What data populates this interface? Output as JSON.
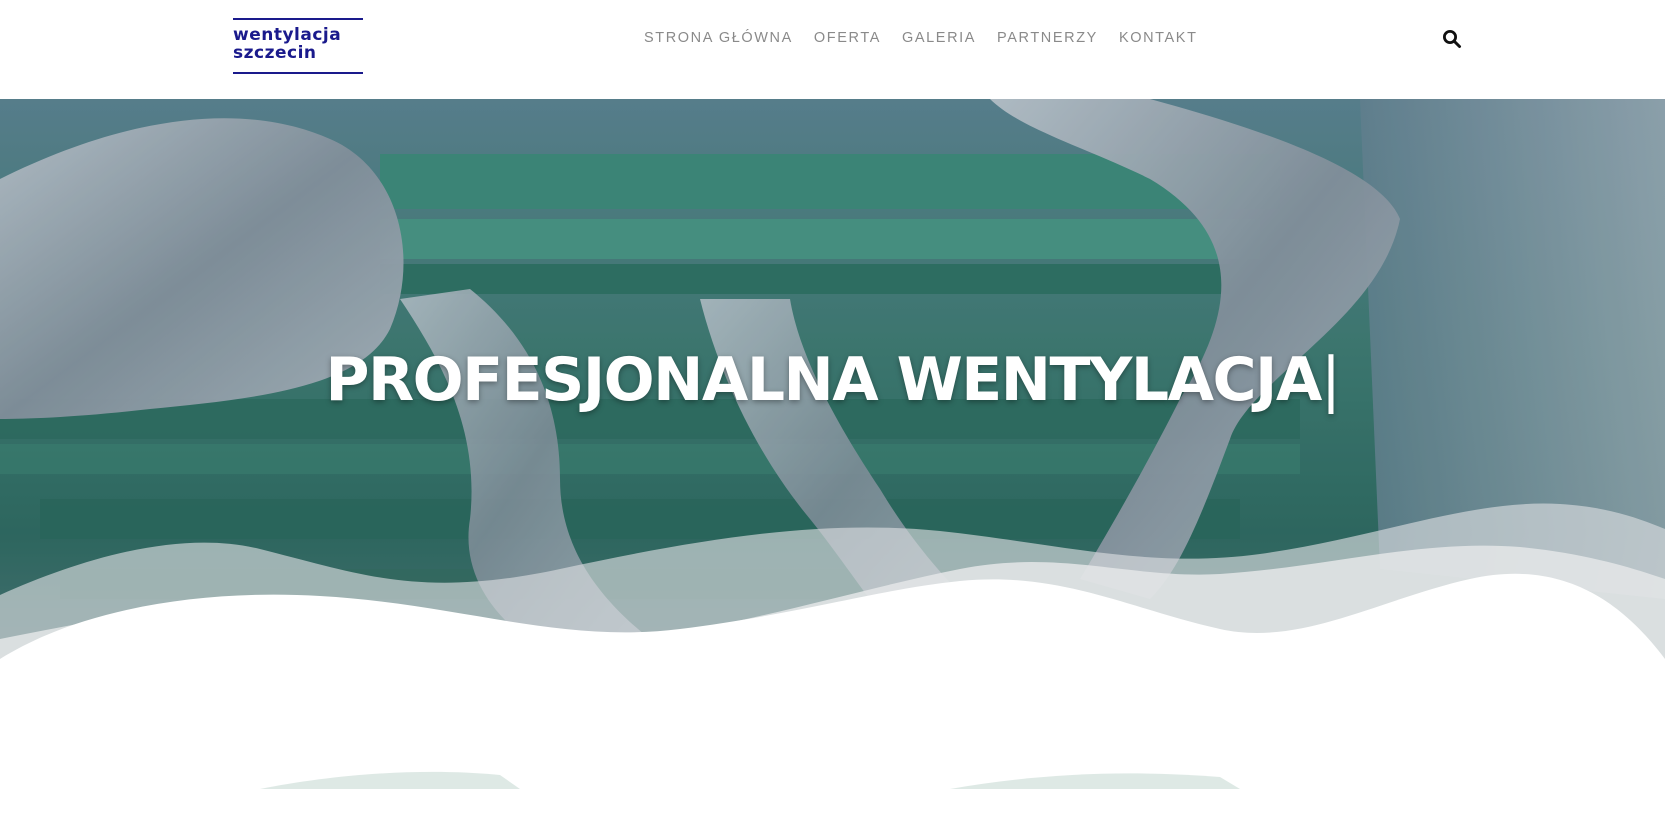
{
  "logo": {
    "line1": "wentylacja",
    "line2": "szczecin",
    "color": "#1a1a8c"
  },
  "nav": {
    "items": [
      {
        "label": "STRONA GŁÓWNA"
      },
      {
        "label": "OFERTA"
      },
      {
        "label": "GALERIA"
      },
      {
        "label": "PARTNERZY"
      },
      {
        "label": "KONTAKT"
      }
    ],
    "search_icon": "search-icon"
  },
  "hero": {
    "title": "PROFESJONALNA WENTYLACJA",
    "cursor": "|",
    "background_description_icon": "ventilation-ducts-photo"
  },
  "colors": {
    "brand": "#1a1a8c",
    "nav_text": "#8a8a8a",
    "hero_text": "#ffffff"
  }
}
